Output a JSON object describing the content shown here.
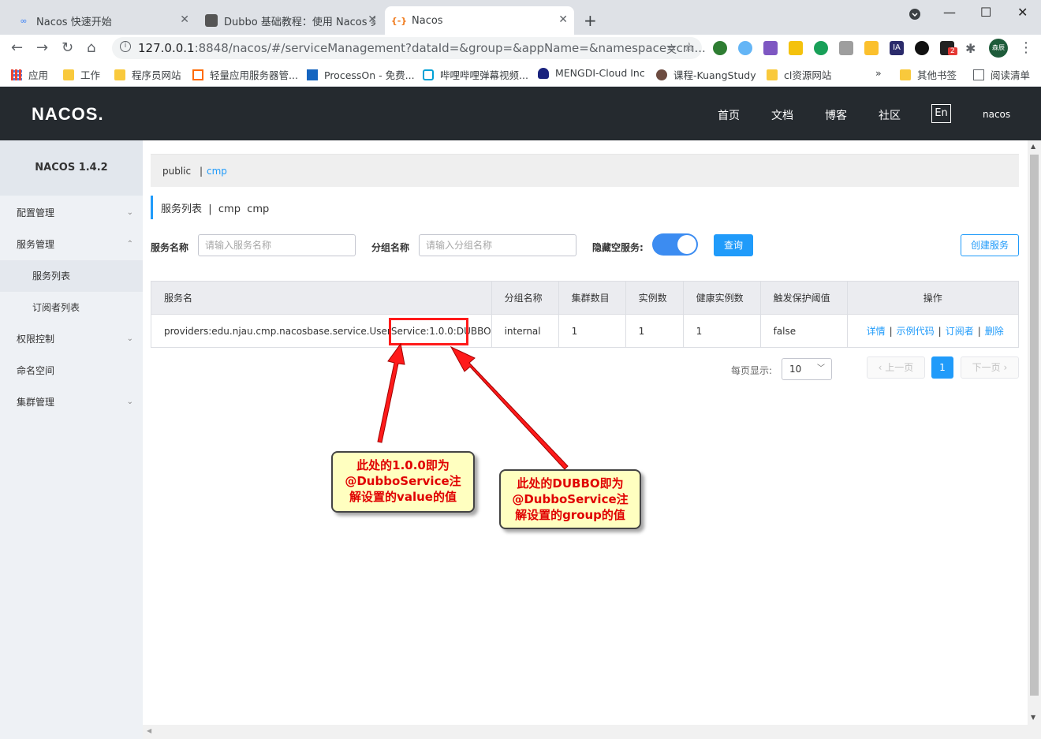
{
  "browser": {
    "tabs": [
      {
        "title": "Nacos 快速开始",
        "active": false
      },
      {
        "title": "Dubbo 基础教程：使用 Nacos 实",
        "active": false
      },
      {
        "title": "Nacos",
        "active": true
      }
    ],
    "url_main": "127.0.0.1",
    "url_rest": ":8848/nacos/#/serviceManagement?dataId=&group=&appName=&namespace=cm...",
    "bookmarks": [
      "应用",
      "工作",
      "程序员网站",
      "轻量应用服务器管...",
      "ProcessOn - 免费...",
      "哔哩哔哩弹幕视频...",
      "MENGDI-Cloud Inc",
      "课程-KuangStudy",
      "cl资源网站",
      "其他书签",
      "阅读清单"
    ],
    "overflow": "»",
    "ext_badge": "2",
    "profile": "森辰"
  },
  "header": {
    "logo": "NACOS.",
    "nav": [
      "首页",
      "文档",
      "博客",
      "社区"
    ],
    "lang": "En",
    "user": "nacos"
  },
  "sidebar": {
    "version": "NACOS 1.4.2",
    "items": [
      {
        "label": "配置管理",
        "chevron": "⌄"
      },
      {
        "label": "服务管理",
        "chevron": "⌃"
      },
      {
        "label": "服务列表"
      },
      {
        "label": "订阅者列表"
      },
      {
        "label": "权限控制",
        "chevron": "⌄"
      },
      {
        "label": "命名空间"
      },
      {
        "label": "集群管理",
        "chevron": "⌄"
      }
    ]
  },
  "namespace_bar": {
    "items": [
      "public",
      "cmp"
    ],
    "separator": "|"
  },
  "page_title": "服务列表  |  cmp  cmp",
  "filters": {
    "service_name_label": "服务名称",
    "service_name_placeholder": "请输入服务名称",
    "group_name_label": "分组名称",
    "group_name_placeholder": "请输入分组名称",
    "hide_empty_label": "隐藏空服务:",
    "query_button": "查询",
    "create_button": "创建服务"
  },
  "table": {
    "columns": [
      "服务名",
      "分组名称",
      "集群数目",
      "实例数",
      "健康实例数",
      "触发保护阈值",
      "操作"
    ],
    "rows": [
      {
        "service": "providers:edu.njau.cmp.nacosbase.service.UserService:1.0.0:DUBBO",
        "group": "internal",
        "clusters": "1",
        "instances": "1",
        "healthy": "1",
        "protect": "false"
      }
    ],
    "ops": [
      "详情",
      "示例代码",
      "订阅者",
      "删除"
    ]
  },
  "pagination": {
    "per_page_label": "每页显示:",
    "page_size": "10",
    "prev": "上一页",
    "current": "1",
    "next": "下一页"
  },
  "annotations": {
    "callout1": [
      "此处的1.0.0即为",
      "@DubboService注",
      "解设置的value的值"
    ],
    "callout2": [
      "此处的DUBBO即为",
      "@DubboService注",
      "解设置的group的值"
    ]
  }
}
